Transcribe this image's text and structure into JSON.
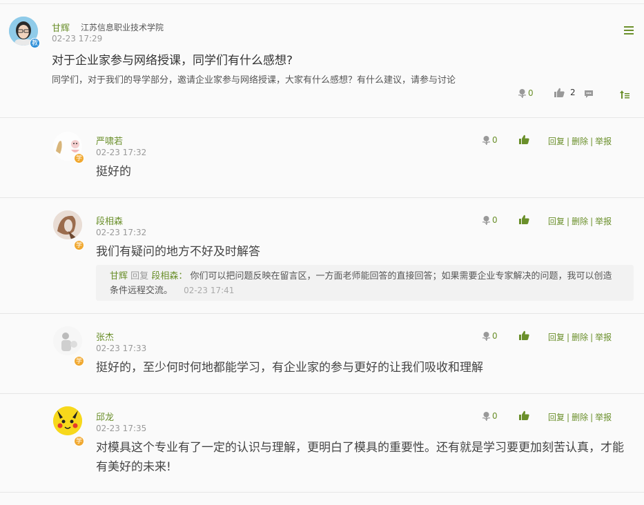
{
  "post": {
    "author": "甘辉",
    "school": "江苏信息职业技术学院",
    "role_badge": "教",
    "time": "02-23 17:29",
    "title": "对于企业家参与网络授课，同学们有什么感想?",
    "body": "同学们，对于我们的导学部分，邀请企业家参与网络授课，大家有什么感想？有什么建议，请参与讨论",
    "flowers": "0",
    "likes": "2"
  },
  "ops": {
    "reply": "回复",
    "sep": "|",
    "delete": "删除",
    "report": "举报"
  },
  "replies": [
    {
      "author": "严啸若",
      "badge": "学",
      "time": "02-23 17:32",
      "text": "挺好的",
      "flowers": "0"
    },
    {
      "author": "段相森",
      "badge": "学",
      "time": "02-23 17:32",
      "text": "我们有疑问的地方不好及时解答",
      "flowers": "0",
      "sub_reply": {
        "author": "甘辉",
        "verb": "回复",
        "target": "段相森：",
        "text": "你们可以把问题反映在留言区，一方面老师能回答的直接回答；如果需要企业专家解决的问题，我可以创造条件远程交流。",
        "time": "02-23 17:41"
      }
    },
    {
      "author": "张杰",
      "badge": "学",
      "time": "02-23 17:33",
      "text": "挺好的，至少何时何地都能学习，有企业家的参与更好的让我们吸收和理解",
      "flowers": "0"
    },
    {
      "author": "邱龙",
      "badge": "学",
      "time": "02-23 17:35",
      "text": "对模具这个专业有了一定的认识与理解，更明白了模具的重要性。还有就是学习要更加刻苦认真，才能有美好的未来!",
      "flowers": "0"
    }
  ],
  "colors": {
    "accent": "#6a8f2a",
    "teacher_badge": "#2e8fd8",
    "student_badge": "#f0a830"
  }
}
